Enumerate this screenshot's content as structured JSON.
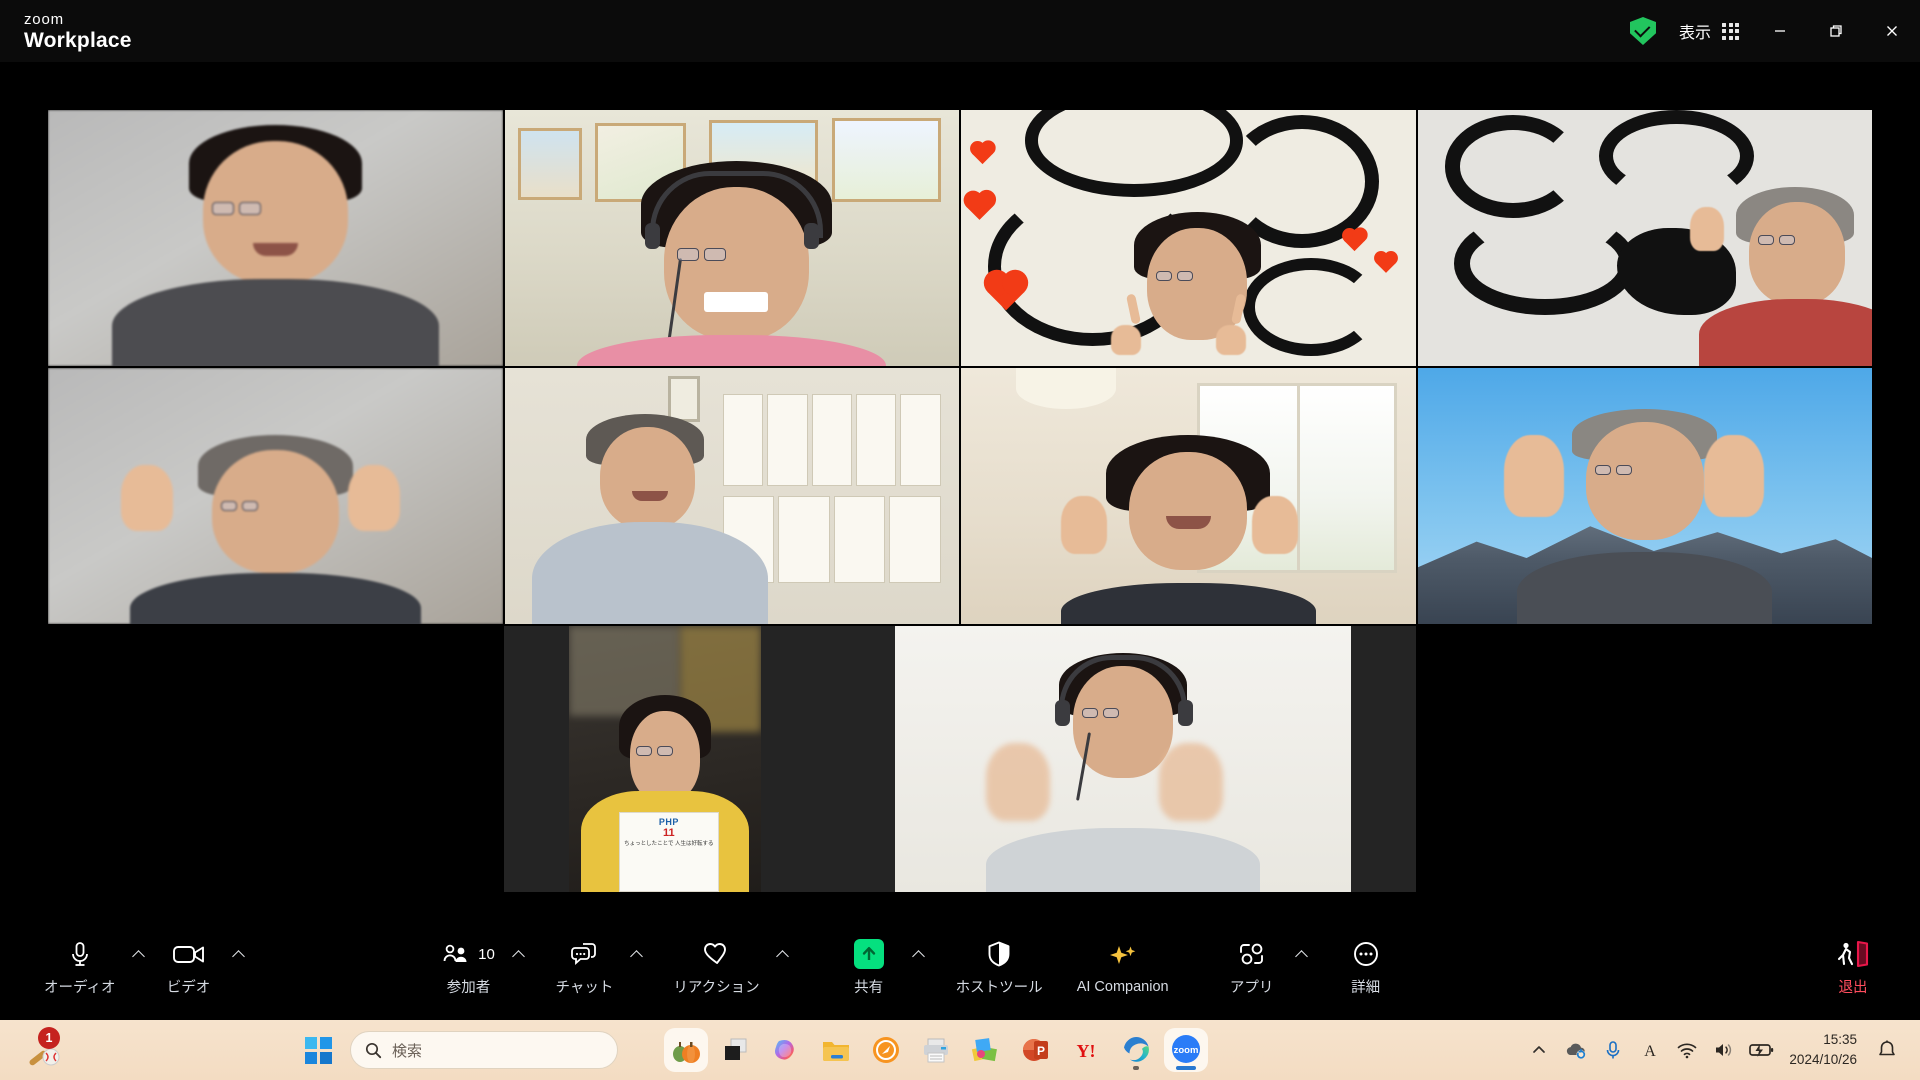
{
  "titlebar": {
    "brand_line1": "zoom",
    "brand_line2": "Workplace",
    "security_icon": "green-shield-check-icon",
    "view_label": "表示",
    "view_grid_icon": "grid-layout-icon",
    "minimize_label": "最小化",
    "restore_label": "元のサイズに戻す",
    "close_label": "閉じる"
  },
  "meeting": {
    "participant_count": "10",
    "active_speaker_border_color": "#00f58c",
    "tiles": [
      {
        "id": "tile-1",
        "scene": "blurred-grey-room",
        "active": false
      },
      {
        "id": "tile-2",
        "scene": "room-with-framed-art",
        "active": true
      },
      {
        "id": "tile-3",
        "scene": "calligraphy-hearts",
        "active": false
      },
      {
        "id": "tile-4",
        "scene": "calligraphy-black-ink",
        "active": false
      },
      {
        "id": "tile-5",
        "scene": "blurred-grey-room-hands",
        "active": false
      },
      {
        "id": "tile-6",
        "scene": "office-documents-wall",
        "active": false
      },
      {
        "id": "tile-7",
        "scene": "living-room-window",
        "active": false
      },
      {
        "id": "tile-8",
        "scene": "mountain-sky",
        "active": false
      },
      {
        "id": "tile-9",
        "scene": "dark-room-magazine",
        "active": false
      },
      {
        "id": "tile-10",
        "scene": "white-wall-headset",
        "active": false
      }
    ],
    "magazine": {
      "title": "PHP",
      "issue": "11",
      "subtitle": "ちょっとしたことで\n人生は好転する"
    }
  },
  "toolbar": {
    "items": [
      {
        "name": "audio",
        "label": "オーディオ",
        "icon": "microphone-icon",
        "caret": true
      },
      {
        "name": "video",
        "label": "ビデオ",
        "icon": "camera-icon",
        "caret": true
      },
      {
        "name": "participants",
        "label": "参加者",
        "icon": "people-icon",
        "caret": true,
        "count": "10"
      },
      {
        "name": "chat",
        "label": "チャット",
        "icon": "chat-bubble-icon",
        "caret": true
      },
      {
        "name": "reactions",
        "label": "リアクション",
        "icon": "heart-icon",
        "caret": true
      },
      {
        "name": "share",
        "label": "共有",
        "icon": "share-arrow-icon",
        "caret": true
      },
      {
        "name": "host-tools",
        "label": "ホストツール",
        "icon": "shield-icon",
        "caret": false
      },
      {
        "name": "ai-companion",
        "label": "AI Companion",
        "icon": "sparkle-icon",
        "caret": false
      },
      {
        "name": "apps",
        "label": "アプリ",
        "icon": "apps-icon",
        "caret": true
      },
      {
        "name": "more",
        "label": "詳細",
        "icon": "ellipsis-icon",
        "caret": false
      }
    ],
    "leave": {
      "label": "退出",
      "icon": "exit-door-icon",
      "color": "#ff4d5e"
    }
  },
  "taskbar": {
    "notification_badge": "1",
    "notification_icon": "baseball-bat-icon",
    "start_icon": "windows-logo-icon",
    "search_placeholder": "検索",
    "search_icon": "search-icon",
    "apps": [
      {
        "name": "pumpkin-widget",
        "icon": "pumpkin-icon",
        "pinned": true,
        "running": false
      },
      {
        "name": "task-view",
        "icon": "task-view-icon",
        "pinned": false,
        "running": false
      },
      {
        "name": "copilot",
        "icon": "copilot-icon",
        "pinned": false,
        "running": false
      },
      {
        "name": "file-explorer",
        "icon": "folder-icon",
        "pinned": false,
        "running": false
      },
      {
        "name": "compass-app",
        "icon": "compass-icon",
        "pinned": false,
        "running": false
      },
      {
        "name": "printer",
        "icon": "printer-icon",
        "pinned": false,
        "running": false
      },
      {
        "name": "photos",
        "icon": "photos-icon",
        "pinned": false,
        "running": false
      },
      {
        "name": "powerpoint",
        "icon": "powerpoint-icon",
        "pinned": false,
        "running": false
      },
      {
        "name": "yahoo-japan",
        "icon": "yahoo-icon",
        "pinned": false,
        "running": false
      },
      {
        "name": "edge",
        "icon": "edge-icon",
        "pinned": false,
        "running": true
      },
      {
        "name": "zoom",
        "icon": "zoom-icon",
        "pinned": true,
        "running": true
      }
    ],
    "tray": [
      {
        "name": "tray-overflow",
        "icon": "chevron-up-icon"
      },
      {
        "name": "onedrive",
        "icon": "onedrive-sync-icon"
      },
      {
        "name": "microphone",
        "icon": "microphone-icon"
      },
      {
        "name": "ime",
        "icon": "ime-a-icon",
        "glyph": "A"
      },
      {
        "name": "wifi",
        "icon": "wifi-icon"
      },
      {
        "name": "volume",
        "icon": "speaker-icon"
      },
      {
        "name": "battery",
        "icon": "battery-charging-icon"
      }
    ],
    "clock_time": "15:35",
    "clock_date": "2024/10/26",
    "notification_bell": "bell-icon"
  }
}
